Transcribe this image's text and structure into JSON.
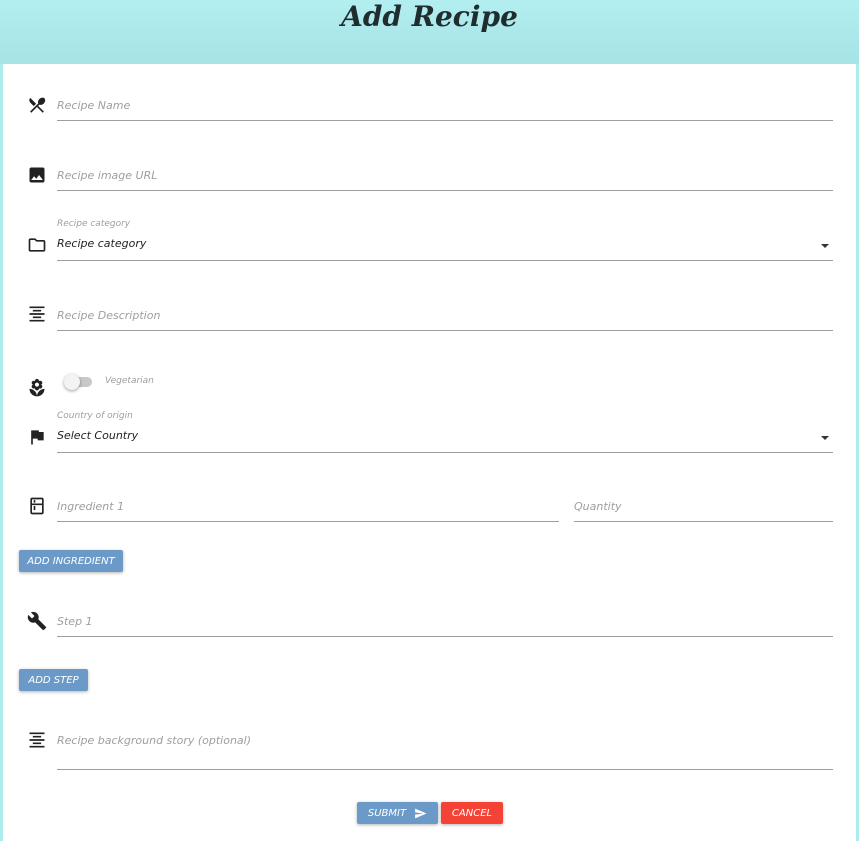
{
  "page": {
    "title": "Add Recipe"
  },
  "form": {
    "recipe_name": {
      "placeholder": "Recipe Name",
      "icon": "utensils-icon"
    },
    "image_url": {
      "placeholder": "Recipe image URL",
      "icon": "image-icon"
    },
    "category": {
      "label": "Recipe category",
      "selected": "Recipe category",
      "icon": "folder-icon"
    },
    "description": {
      "placeholder": "Recipe Description",
      "icon": "align-center-icon"
    },
    "vegetarian": {
      "label": "Vegetarian",
      "checked": false,
      "icon": "flower-icon"
    },
    "country": {
      "label": "Country of origin",
      "selected": "Select Country",
      "icon": "flag-icon"
    },
    "ingredient": {
      "placeholder": "Ingredient 1",
      "quantity_placeholder": "Quantity",
      "icon": "kitchen-icon"
    },
    "add_ingredient_label": "ADD INGREDIENT",
    "step": {
      "placeholder": "Step 1",
      "icon": "wrench-icon"
    },
    "add_step_label": "ADD STEP",
    "background_story": {
      "placeholder": "Recipe background story (optional)",
      "icon": "align-center-icon"
    },
    "submit_label": "SUBMIT",
    "cancel_label": "CANCEL"
  },
  "colors": {
    "header_bg": "#aeebec",
    "button_blue": "#6b9ac8",
    "button_red": "#f44336"
  }
}
